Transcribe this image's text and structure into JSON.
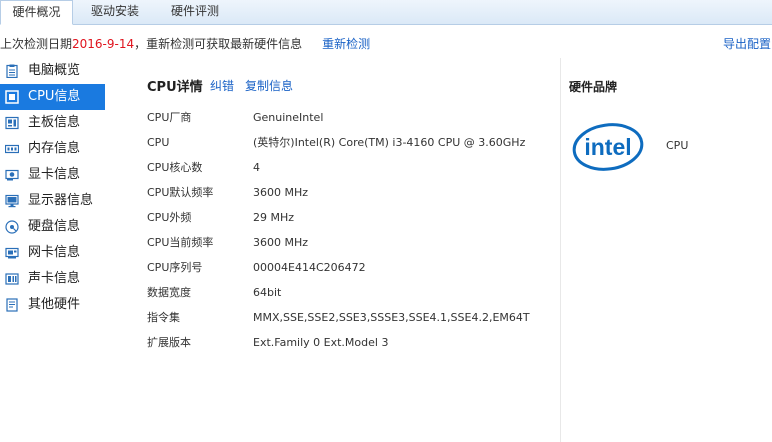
{
  "tabs": [
    "硬件概况",
    "驱动安装",
    "硬件评测"
  ],
  "info": {
    "prefix": "上次检测日期",
    "date": "2016-9-14",
    "suffix": "，重新检测可获取最新硬件信息",
    "redetect": "重新检测",
    "export": "导出配置"
  },
  "sidebar": {
    "items": [
      {
        "label": "电脑概览",
        "icon": "clipboard-icon"
      },
      {
        "label": "CPU信息",
        "icon": "cpu-icon"
      },
      {
        "label": "主板信息",
        "icon": "motherboard-icon"
      },
      {
        "label": "内存信息",
        "icon": "memory-icon"
      },
      {
        "label": "显卡信息",
        "icon": "graphics-card-icon"
      },
      {
        "label": "显示器信息",
        "icon": "monitor-icon"
      },
      {
        "label": "硬盘信息",
        "icon": "hard-disk-icon"
      },
      {
        "label": "网卡信息",
        "icon": "network-card-icon"
      },
      {
        "label": "声卡信息",
        "icon": "sound-card-icon"
      },
      {
        "label": "其他硬件",
        "icon": "other-hardware-icon"
      }
    ]
  },
  "detail": {
    "title": "CPU详情",
    "report": "纠错",
    "copy": "复制信息",
    "rows": [
      {
        "label": "CPU厂商",
        "value": "GenuineIntel"
      },
      {
        "label": "CPU",
        "value": "(英特尔)Intel(R) Core(TM) i3-4160 CPU @ 3.60GHz"
      },
      {
        "label": "CPU核心数",
        "value": "4"
      },
      {
        "label": "CPU默认频率",
        "value": "3600 MHz"
      },
      {
        "label": "CPU外频",
        "value": "29 MHz"
      },
      {
        "label": "CPU当前频率",
        "value": "3600 MHz"
      },
      {
        "label": "CPU序列号",
        "value": "00004E414C206472"
      },
      {
        "label": "数据宽度",
        "value": "64bit"
      },
      {
        "label": "指令集",
        "value": "MMX,SSE,SSE2,SSE3,SSSE3,SSE4.1,SSE4.2,EM64T"
      },
      {
        "label": "扩展版本",
        "value": "Ext.Family 0  Ext.Model 3"
      }
    ]
  },
  "brand": {
    "title": "硬件品牌",
    "logo_text": "intel",
    "name": "CPU"
  },
  "colors": {
    "accent": "#1a7ae0",
    "link": "#1a62c6",
    "date": "#e0141e",
    "intel_blue": "#0e6cbf"
  }
}
